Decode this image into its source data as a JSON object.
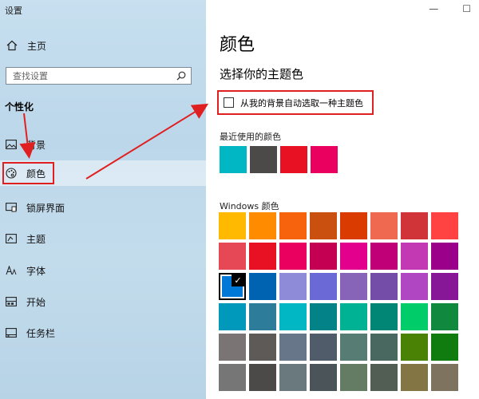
{
  "window": {
    "title": "设置",
    "minimize_glyph": "—",
    "maximize_glyph": "☐"
  },
  "sidebar": {
    "home": {
      "label": "主页",
      "icon": "home-icon"
    },
    "search": {
      "placeholder": "查找设置",
      "icon": "search-icon"
    },
    "section": "个性化",
    "items": [
      {
        "label": "背景",
        "icon": "picture-icon",
        "selected": false
      },
      {
        "label": "颜色",
        "icon": "palette-icon",
        "selected": true
      },
      {
        "label": "锁屏界面",
        "icon": "lock-screen-icon",
        "selected": false
      },
      {
        "label": "主题",
        "icon": "theme-icon",
        "selected": false
      },
      {
        "label": "字体",
        "icon": "font-icon",
        "selected": false
      },
      {
        "label": "开始",
        "icon": "start-icon",
        "selected": false
      },
      {
        "label": "任务栏",
        "icon": "taskbar-icon",
        "selected": false
      }
    ]
  },
  "main": {
    "title": "颜色",
    "subhead": "选择你的主题色",
    "auto_option": {
      "label": "从我的背景自动选取一种主题色",
      "checked": false
    },
    "recent_label": "最近使用的颜色",
    "recent_colors": [
      "#00b7c3",
      "#4c4a48",
      "#e81123",
      "#ea005e"
    ],
    "windows_label": "Windows 颜色",
    "windows_colors": [
      "#ffb900",
      "#ff8c00",
      "#f7630c",
      "#ca5010",
      "#da3b01",
      "#ef6950",
      "#d13438",
      "#ff4343",
      "#e74856",
      "#e81123",
      "#ea005e",
      "#c30052",
      "#e3008c",
      "#bf0077",
      "#c239b3",
      "#9a0089",
      "#0078d7",
      "#0063b1",
      "#8e8cd8",
      "#6b69d6",
      "#8764b8",
      "#744da9",
      "#b146c2",
      "#881798",
      "#0099bc",
      "#2d7d9a",
      "#00b7c3",
      "#038387",
      "#00b294",
      "#018574",
      "#00cc6a",
      "#10893e",
      "#7a7574",
      "#5d5a58",
      "#68768a",
      "#515c6b",
      "#567c73",
      "#486860",
      "#498205",
      "#107c10",
      "#767676",
      "#4c4a48",
      "#69797e",
      "#4a5459",
      "#647c64",
      "#525e54",
      "#847545",
      "#7e735f"
    ],
    "selected_color_index": 16,
    "selected_mark": "✓"
  },
  "annotation_color": "#e02020"
}
